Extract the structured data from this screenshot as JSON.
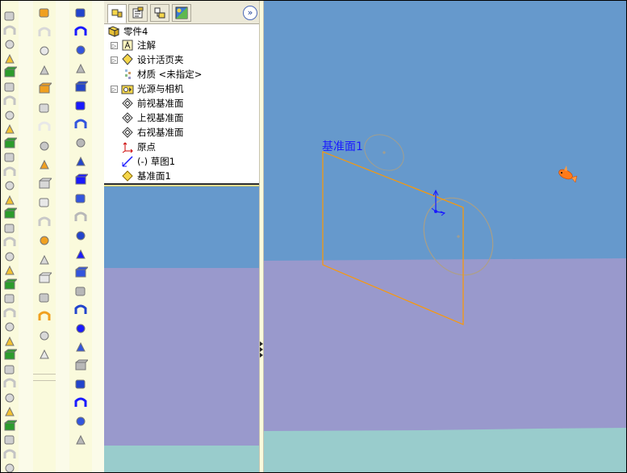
{
  "feature_tree": {
    "tabs": [
      {
        "name": "featuremanager",
        "icon": "feature-tree-icon",
        "active": true
      },
      {
        "name": "propertymanager",
        "icon": "property-icon",
        "active": false
      },
      {
        "name": "configurationmanager",
        "icon": "configuration-icon",
        "active": false
      },
      {
        "name": "displaymanager",
        "icon": "display-icon",
        "active": false
      }
    ],
    "expand_button": "»",
    "root": "零件4",
    "items": [
      {
        "label": "注解",
        "icon": "annotation-icon",
        "expandable": true
      },
      {
        "label": "设计活页夹",
        "icon": "design-binder-icon",
        "expandable": true
      },
      {
        "label": "材质 <未指定>",
        "icon": "material-icon",
        "expandable": false
      },
      {
        "label": "光源与相机",
        "icon": "lights-cameras-icon",
        "expandable": true
      },
      {
        "label": "前视基准面",
        "icon": "plane-icon",
        "expandable": false
      },
      {
        "label": "上视基准面",
        "icon": "plane-icon",
        "expandable": false
      },
      {
        "label": "右视基准面",
        "icon": "plane-icon",
        "expandable": false
      },
      {
        "label": "原点",
        "icon": "origin-icon",
        "expandable": false
      },
      {
        "label": "(-) 草图1",
        "icon": "sketch-icon",
        "expandable": false
      },
      {
        "label": "基准面1",
        "icon": "plane-selected-icon",
        "expandable": false
      }
    ]
  },
  "viewport": {
    "plane_label": "基准面1",
    "colors": {
      "sky": "#6699cc",
      "floor": "#9999cc",
      "ground": "#99cccc",
      "plane_edge": "#ff9900",
      "label": "#1a1aff"
    }
  }
}
